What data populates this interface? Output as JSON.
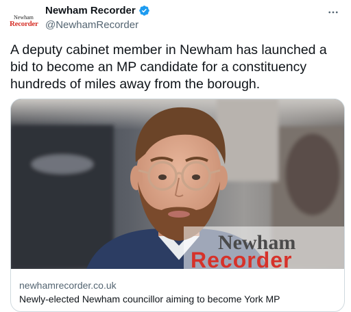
{
  "account": {
    "display_name": "Newham Recorder",
    "handle": "@NewhamRecorder",
    "verified": true,
    "avatar_logo_top": "Newham",
    "avatar_logo_bottom": "Recorder"
  },
  "tweet": {
    "text": "A deputy cabinet member in Newham has launched a bid to become an MP candidate for a constituency hundreds of miles away from the borough."
  },
  "link_card": {
    "watermark_top": "Newham",
    "watermark_bottom": "Recorder",
    "domain": "newhamrecorder.co.uk",
    "title": "Newly-elected Newham councillor aiming to become York MP"
  },
  "icons": {
    "verified": "verified-badge-icon",
    "more": "more-options-icon"
  },
  "colors": {
    "verified_blue": "#1d9bf0",
    "brand_red": "#d6322a",
    "secondary_text": "#536471",
    "border": "#cfd9de"
  }
}
